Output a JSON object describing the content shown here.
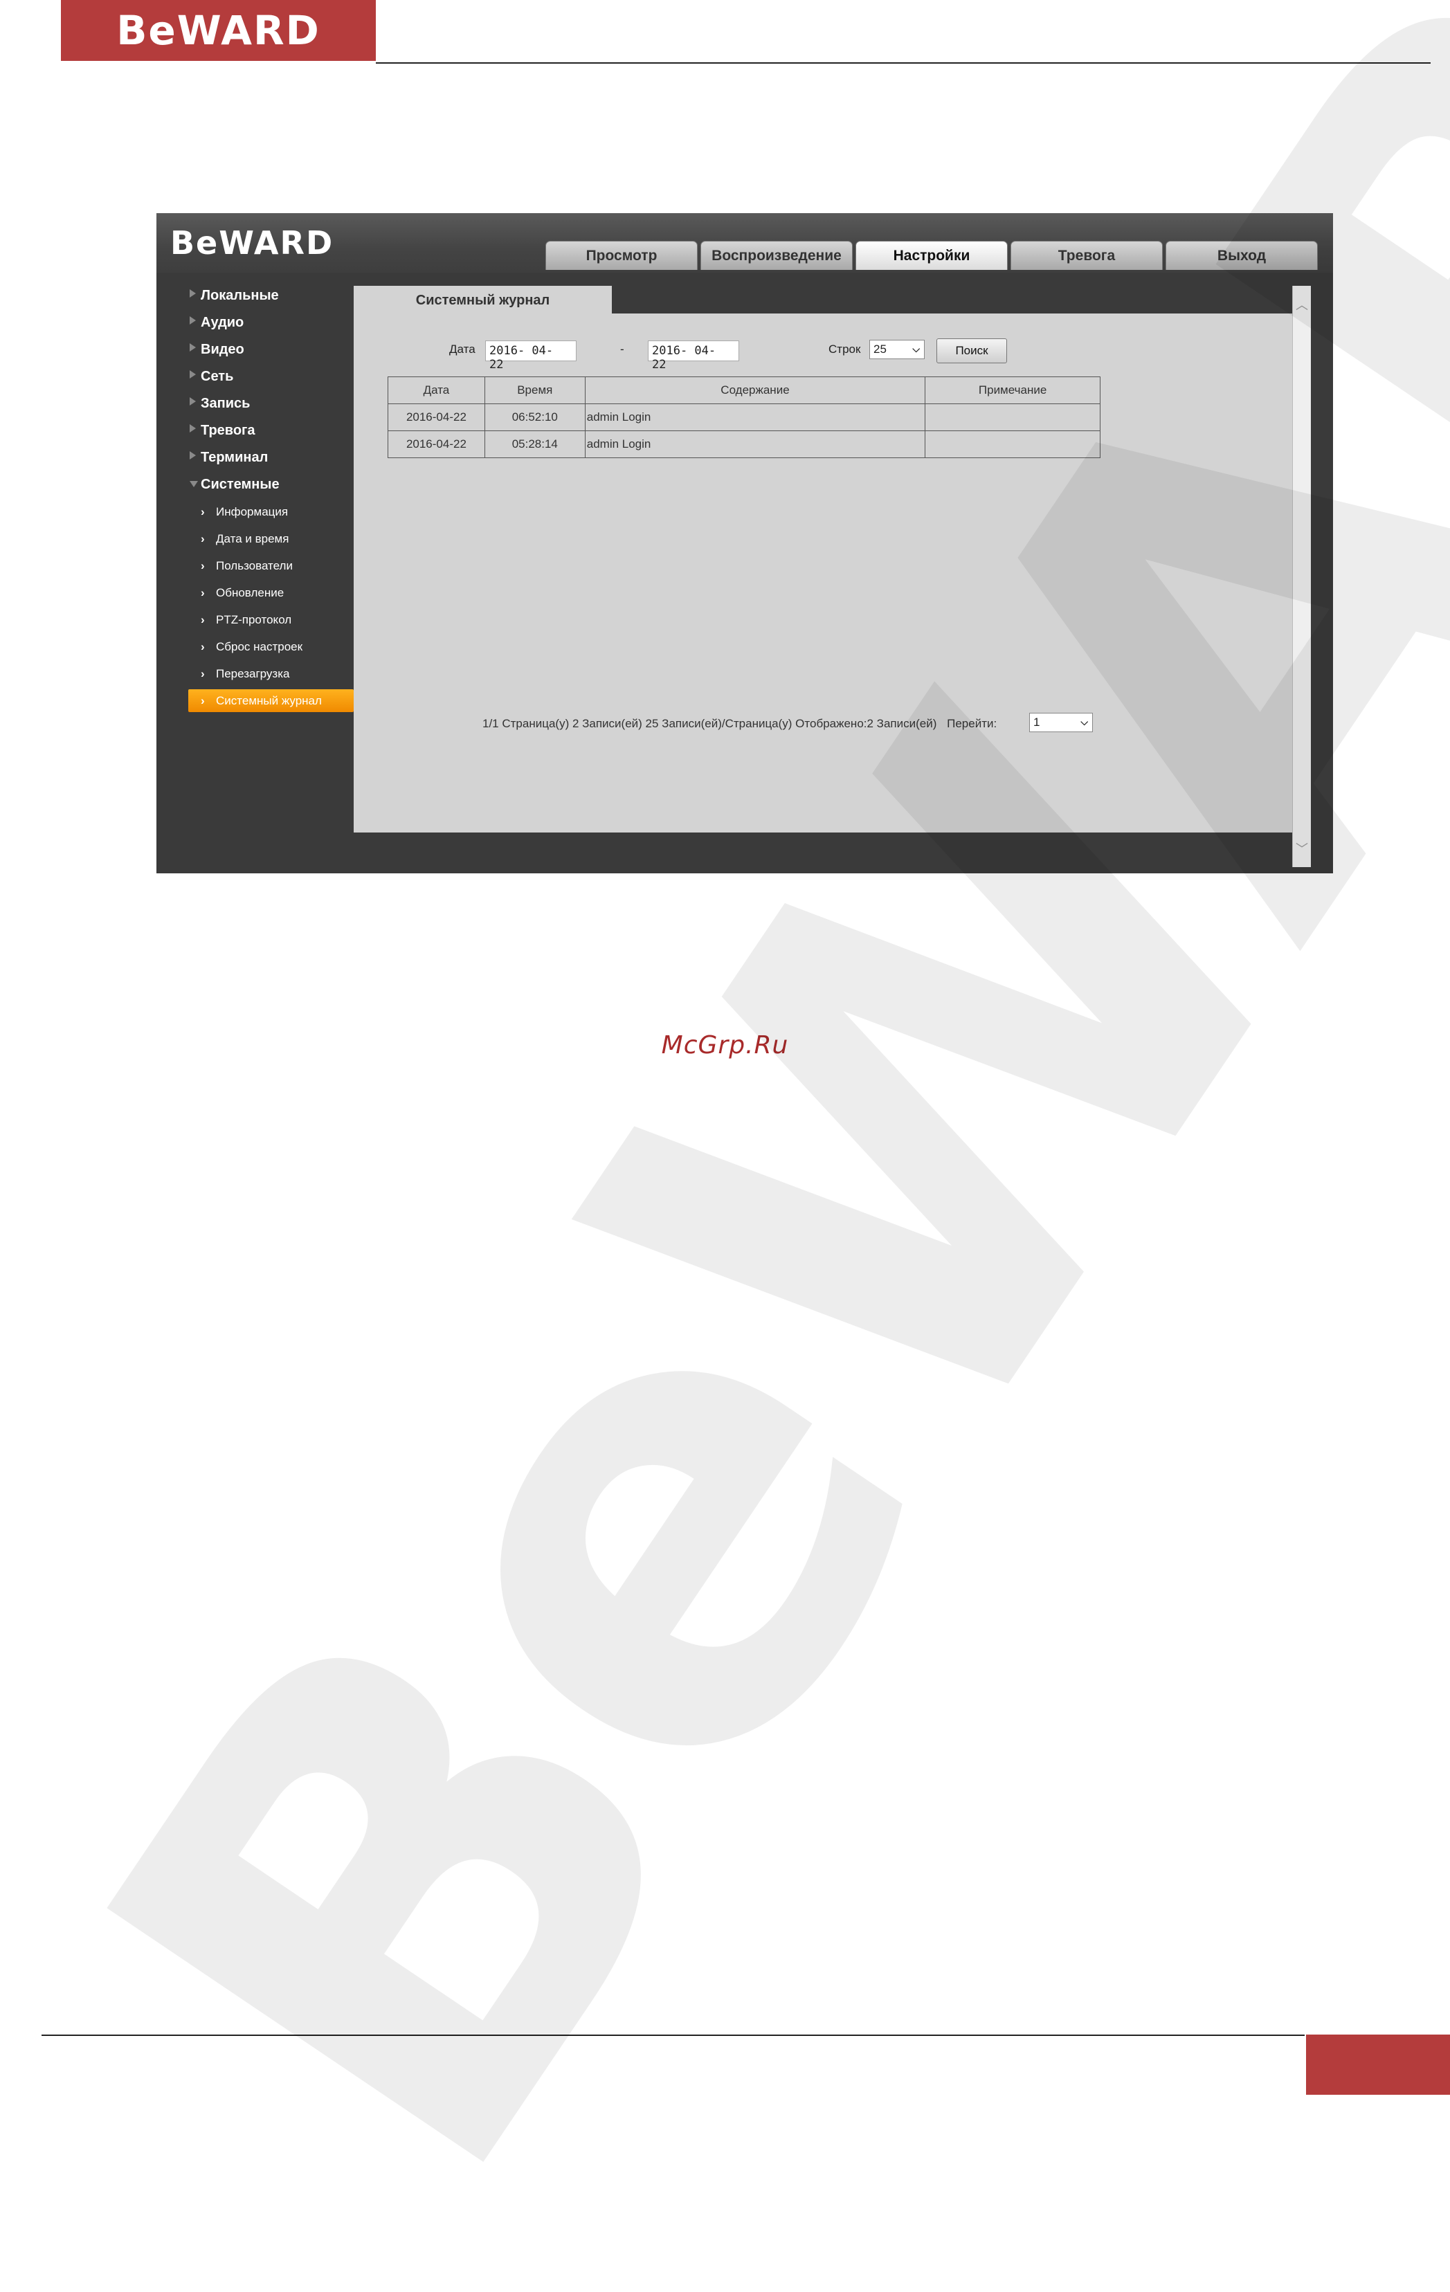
{
  "document": {
    "header_logo": "BeWARD",
    "watermark_text": "McGrp.Ru"
  },
  "app": {
    "logo": "BeWARD",
    "tabs": [
      {
        "label": "Просмотр",
        "active": false
      },
      {
        "label": "Воспроизведение",
        "active": false
      },
      {
        "label": "Настройки",
        "active": true
      },
      {
        "label": "Тревога",
        "active": false
      },
      {
        "label": "Выход",
        "active": false
      }
    ],
    "sidebar": {
      "sections": [
        {
          "label": "Локальные"
        },
        {
          "label": "Аудио"
        },
        {
          "label": "Видео"
        },
        {
          "label": "Сеть"
        },
        {
          "label": "Запись"
        },
        {
          "label": "Тревога"
        },
        {
          "label": "Терминал"
        },
        {
          "label": "Системные"
        }
      ],
      "sub_items": [
        {
          "label": "Информация"
        },
        {
          "label": "Дата и время"
        },
        {
          "label": "Пользователи"
        },
        {
          "label": "Обновление"
        },
        {
          "label": "PTZ-протокол"
        },
        {
          "label": "Сброс настроек"
        },
        {
          "label": "Перезагрузка"
        },
        {
          "label": "Системный журнал"
        }
      ]
    },
    "panel": {
      "title": "Системный журнал",
      "filter": {
        "date_label": "Дата",
        "date_from": "2016- 04- 22",
        "dash": "-",
        "date_to": "2016- 04- 22",
        "rows_label": "Строк",
        "rows_value": "25",
        "search_label": "Поиск"
      },
      "table": {
        "headers": [
          "Дата",
          "Время",
          "Содержание",
          "Примечание"
        ],
        "rows": [
          [
            "2016-04-22",
            "06:52:10",
            "admin Login",
            ""
          ],
          [
            "2016-04-22",
            "05:28:14",
            "admin Login",
            ""
          ]
        ]
      },
      "pager": {
        "text": "1/1 Страница(у) 2 Записи(ей) 25 Записи(ей)/Страница(у) Отображено:2 Записи(ей)",
        "goto_label": "Перейти:",
        "page_value": "1"
      }
    }
  },
  "colors": {
    "brand_red": "#b43c3c",
    "active_orange": "#f5a000",
    "dark_bg": "#3a3a3a",
    "panel_bg": "#d3d3d3"
  }
}
